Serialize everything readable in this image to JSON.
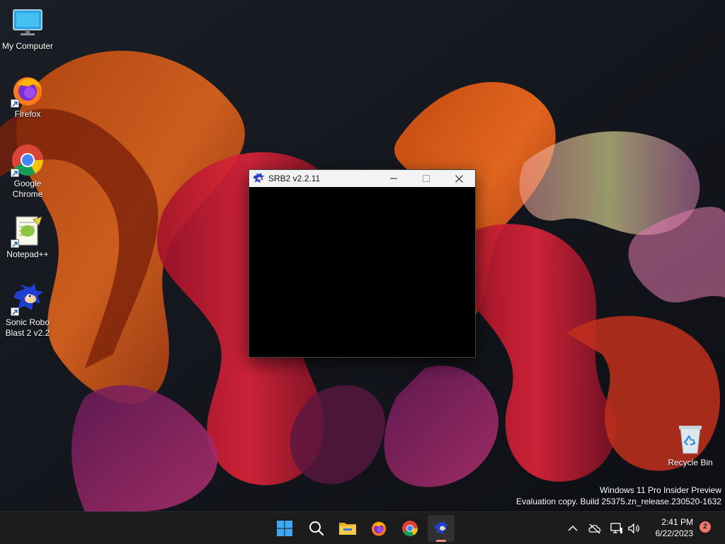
{
  "desktop": {
    "icons": [
      {
        "label": "My Computer",
        "icon": "monitor-icon"
      },
      {
        "label": "Firefox",
        "icon": "firefox-icon"
      },
      {
        "label": "Google Chrome",
        "icon": "chrome-icon"
      },
      {
        "label": "Notepad++",
        "icon": "notepadpp-icon"
      },
      {
        "label": "Sonic Robo Blast 2 v2.2",
        "icon": "sonic-icon"
      },
      {
        "label": "Recycle Bin",
        "icon": "recycle-bin-icon"
      }
    ]
  },
  "window": {
    "title": "SRB2 v2.2.11",
    "icon": "sonic-icon"
  },
  "watermark": {
    "line1": "Windows 11 Pro Insider Preview",
    "line2": "Evaluation copy. Build 25375.zn_release.230520-1632"
  },
  "taskbar": {
    "apps": [
      {
        "name": "start",
        "icon": "windows-start-icon"
      },
      {
        "name": "search",
        "icon": "search-icon"
      },
      {
        "name": "file-explorer",
        "icon": "folder-icon"
      },
      {
        "name": "firefox",
        "icon": "firefox-icon"
      },
      {
        "name": "chrome",
        "icon": "chrome-icon"
      },
      {
        "name": "srb2",
        "icon": "sonic-icon",
        "active": true
      }
    ],
    "tray": {
      "icons": [
        "chevron-up-icon",
        "cloud-offline-icon",
        "network-icon",
        "volume-icon"
      ],
      "time": "2:41 PM",
      "date": "6/22/2023",
      "notification_count": "2"
    }
  },
  "colors": {
    "taskbar_bg": "#1c1c1c",
    "titlebar_bg": "#f3f3f3",
    "badge": "#f0776b",
    "active_indicator": "#f08a7a"
  }
}
